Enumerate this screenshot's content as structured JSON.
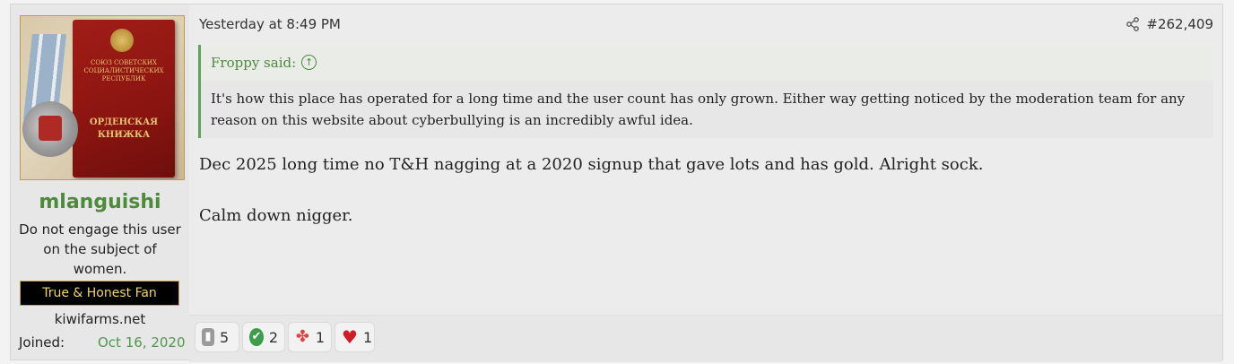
{
  "post": {
    "user": {
      "avatar_book_small": "СОЮЗ СОВЕТСКИХ СОЦИАЛИСТИЧЕСКИХ РЕСПУБЛИК",
      "avatar_book_big": "ОРДЕНСКАЯ КНИЖКА",
      "username": "mlanguishi",
      "user_title": "Do not engage this user on the subject of women.",
      "banner": "True & Honest Fan",
      "site": "kiwifarms.net",
      "joined_label": "Joined:",
      "joined_value": "Oct 16, 2020"
    },
    "date": "Yesterday at 8:49 PM",
    "post_number": "#262,409",
    "quote": {
      "author_line": "Froppy said:",
      "text": "It's how this place has operated for a long time and the user count has only grown. Either way getting noticed by the moderation team for any reason on this website about cyberbullying is an incredibly awful idea."
    },
    "body": [
      "Dec 2025 long time no T&H nagging at a 2020 signup that gave lots and has gold. Alright sock.",
      "Calm down nigger."
    ],
    "reactions": [
      {
        "icon": "feels-icon",
        "count": "5"
      },
      {
        "icon": "agree-icon",
        "count": "2"
      },
      {
        "icon": "puzzle-icon",
        "count": "1"
      },
      {
        "icon": "heart-icon",
        "count": "1"
      }
    ]
  },
  "colors": {
    "username": "#4d8a3c",
    "quote_border": "#5fa35a",
    "banner_text": "#f0d36a",
    "joined_value": "#4d9a4d"
  }
}
